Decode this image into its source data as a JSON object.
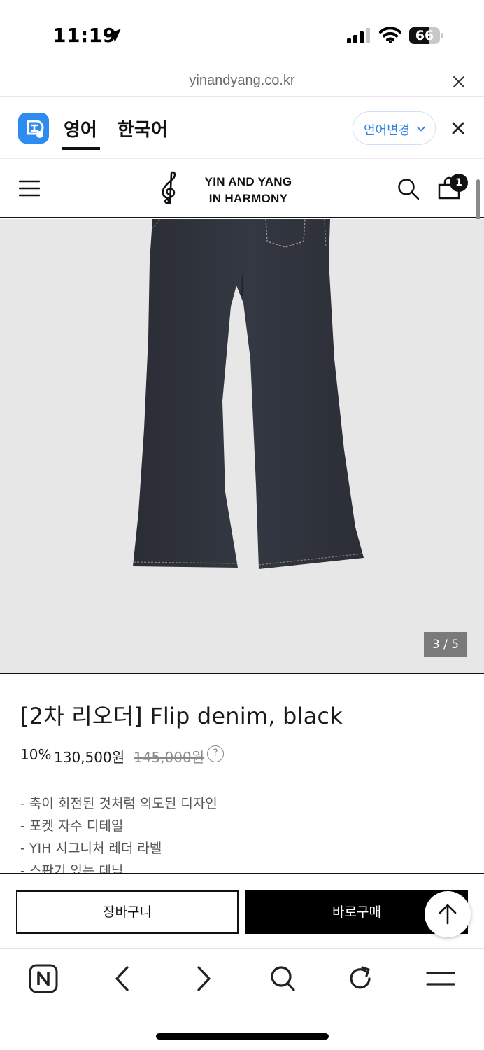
{
  "status_bar": {
    "time": "11:19",
    "battery": "66",
    "battery_level": 0.66
  },
  "url_bar": {
    "domain": "yinandyang.co.kr"
  },
  "translate_bar": {
    "tab_english": "영어",
    "tab_korean": "한국어",
    "change_language": "언어변경",
    "accent_color": "#2e82e6"
  },
  "header": {
    "logo_line1": "YIN AND YANG",
    "logo_line2": "IN HARMONY",
    "cart_count": "1"
  },
  "gallery": {
    "counter": "3 / 5"
  },
  "product": {
    "title": "[2차 리오더] Flip denim, black",
    "discount": "10%",
    "sale_price": "130,500원",
    "original_price": "145,000원",
    "help_label": "?",
    "description": [
      "- 축이 회전된 것처럼 의도된 디자인",
      "- 포켓 자수 디테일",
      "- YIH 시그니처 레더 라벨",
      "- 스판기 있는 데님"
    ]
  },
  "actions": {
    "cart_label": "장바구니",
    "buy_label": "바로구매"
  },
  "icons": [
    "location-arrow-icon",
    "signal-icon",
    "wifi-icon",
    "close-icon",
    "translate-logo-icon",
    "chevron-down-icon",
    "menu-icon",
    "treble-clef-logo-icon",
    "search-icon",
    "bag-icon",
    "arrow-up-icon",
    "naver-home-icon",
    "back-icon",
    "forward-icon",
    "search-icon",
    "refresh-icon",
    "menu-icon"
  ]
}
